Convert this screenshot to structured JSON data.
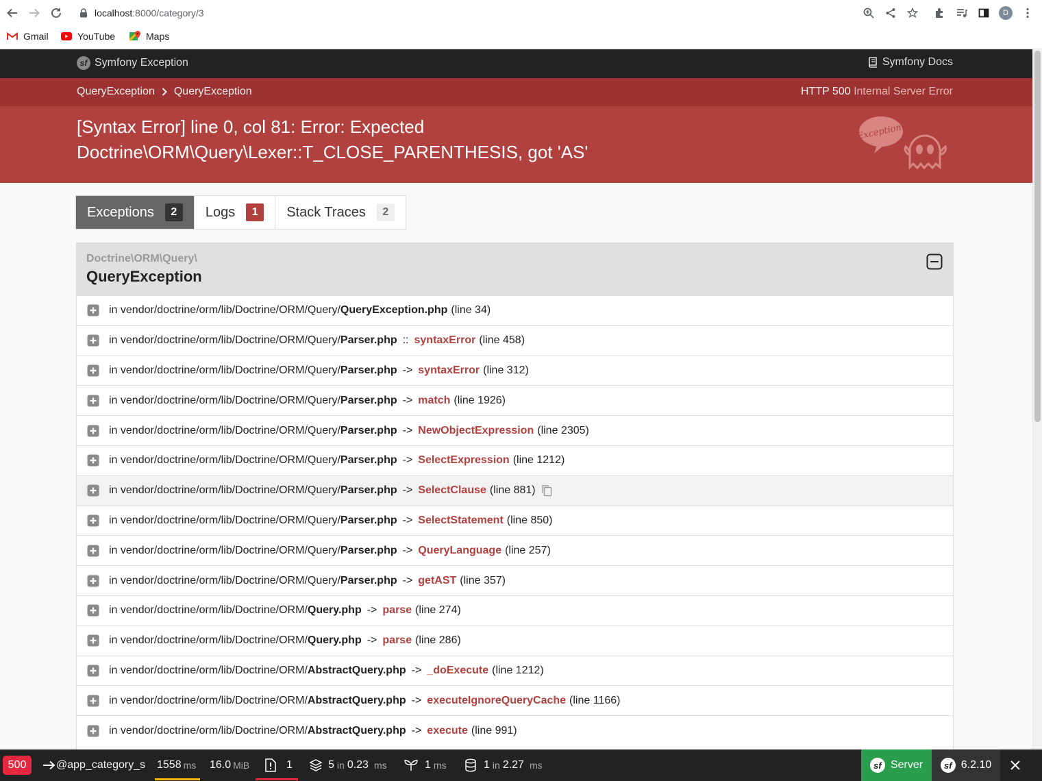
{
  "browser": {
    "url_host": "localhost",
    "url_path": ":8000/category/3",
    "avatar_letter": "D",
    "bookmarks": [
      {
        "label": "Gmail",
        "icon": "gmail-icon"
      },
      {
        "label": "YouTube",
        "icon": "youtube-icon"
      },
      {
        "label": "Maps",
        "icon": "maps-icon"
      }
    ]
  },
  "header": {
    "brand": "Symfony Exception",
    "docs": "Symfony Docs"
  },
  "breadcrumb": {
    "items": [
      "QueryException",
      "QueryException"
    ],
    "status_code": "HTTP 500",
    "status_text": "Internal Server Error"
  },
  "exception": {
    "message_line1": "[Syntax Error] line 0, col 81: Error: Expected",
    "message_line2": "Doctrine\\ORM\\Query\\Lexer::T_CLOSE_PARENTHESIS, got 'AS'",
    "logo_text": "Exception!"
  },
  "tabs": [
    {
      "label": "Exceptions",
      "count": "2"
    },
    {
      "label": "Logs",
      "count": "1"
    },
    {
      "label": "Stack Traces",
      "count": "2"
    }
  ],
  "trace": {
    "namespace": "Doctrine\\ORM\\Query\\",
    "class": "QueryException",
    "rows": [
      {
        "prefix": "in vendor/doctrine/orm/lib/Doctrine/ORM/Query/",
        "file": "QueryException.php",
        "sep": "",
        "fn": "",
        "line": "(line 34)"
      },
      {
        "prefix": "in vendor/doctrine/orm/lib/Doctrine/ORM/Query/",
        "file": "Parser.php",
        "sep": "::",
        "fn": "syntaxError",
        "line": "(line 458)"
      },
      {
        "prefix": "in vendor/doctrine/orm/lib/Doctrine/ORM/Query/",
        "file": "Parser.php",
        "sep": "->",
        "fn": "syntaxError",
        "line": "(line 312)"
      },
      {
        "prefix": "in vendor/doctrine/orm/lib/Doctrine/ORM/Query/",
        "file": "Parser.php",
        "sep": "->",
        "fn": "match",
        "line": "(line 1926)"
      },
      {
        "prefix": "in vendor/doctrine/orm/lib/Doctrine/ORM/Query/",
        "file": "Parser.php",
        "sep": "->",
        "fn": "NewObjectExpression",
        "line": "(line 2305)"
      },
      {
        "prefix": "in vendor/doctrine/orm/lib/Doctrine/ORM/Query/",
        "file": "Parser.php",
        "sep": "->",
        "fn": "SelectExpression",
        "line": "(line 1212)"
      },
      {
        "prefix": "in vendor/doctrine/orm/lib/Doctrine/ORM/Query/",
        "file": "Parser.php",
        "sep": "->",
        "fn": "SelectClause",
        "line": "(line 881)"
      },
      {
        "prefix": "in vendor/doctrine/orm/lib/Doctrine/ORM/Query/",
        "file": "Parser.php",
        "sep": "->",
        "fn": "SelectStatement",
        "line": "(line 850)"
      },
      {
        "prefix": "in vendor/doctrine/orm/lib/Doctrine/ORM/Query/",
        "file": "Parser.php",
        "sep": "->",
        "fn": "QueryLanguage",
        "line": "(line 257)"
      },
      {
        "prefix": "in vendor/doctrine/orm/lib/Doctrine/ORM/Query/",
        "file": "Parser.php",
        "sep": "->",
        "fn": "getAST",
        "line": "(line 357)"
      },
      {
        "prefix": "in vendor/doctrine/orm/lib/Doctrine/ORM/",
        "file": "Query.php",
        "sep": "->",
        "fn": "parse",
        "line": "(line 274)"
      },
      {
        "prefix": "in vendor/doctrine/orm/lib/Doctrine/ORM/",
        "file": "Query.php",
        "sep": "->",
        "fn": "parse",
        "line": "(line 286)"
      },
      {
        "prefix": "in vendor/doctrine/orm/lib/Doctrine/ORM/",
        "file": "AbstractQuery.php",
        "sep": "->",
        "fn": "_doExecute",
        "line": "(line 1212)"
      },
      {
        "prefix": "in vendor/doctrine/orm/lib/Doctrine/ORM/",
        "file": "AbstractQuery.php",
        "sep": "->",
        "fn": "executeIgnoreQueryCache",
        "line": "(line 1166)"
      },
      {
        "prefix": "in vendor/doctrine/orm/lib/Doctrine/ORM/",
        "file": "AbstractQuery.php",
        "sep": "->",
        "fn": "execute",
        "line": "(line 991)"
      }
    ]
  },
  "toolbar": {
    "status": "500",
    "route": "@app_category_s",
    "time_value": "1558",
    "time_unit": "ms",
    "memory_value": "16.0",
    "memory_unit": "MiB",
    "logs_count": "1",
    "cache_count": "5",
    "cache_in": "in",
    "cache_time": "0.23",
    "cache_unit": "ms",
    "twig_time": "1",
    "twig_unit": "ms",
    "db_count": "1",
    "db_in": "in",
    "db_time": "2.27",
    "db_unit": "ms",
    "server_label": "Server",
    "version": "6.2.10",
    "colors": {
      "time": "#f0b400",
      "logs": "#e5283f",
      "server": "#2b9e4d",
      "status": "#e5283f"
    }
  },
  "colors": {
    "header_bg": "#222222",
    "crumb_bg": "#9c3232",
    "message_bg": "#b0413e",
    "function_name": "#b0413e"
  }
}
